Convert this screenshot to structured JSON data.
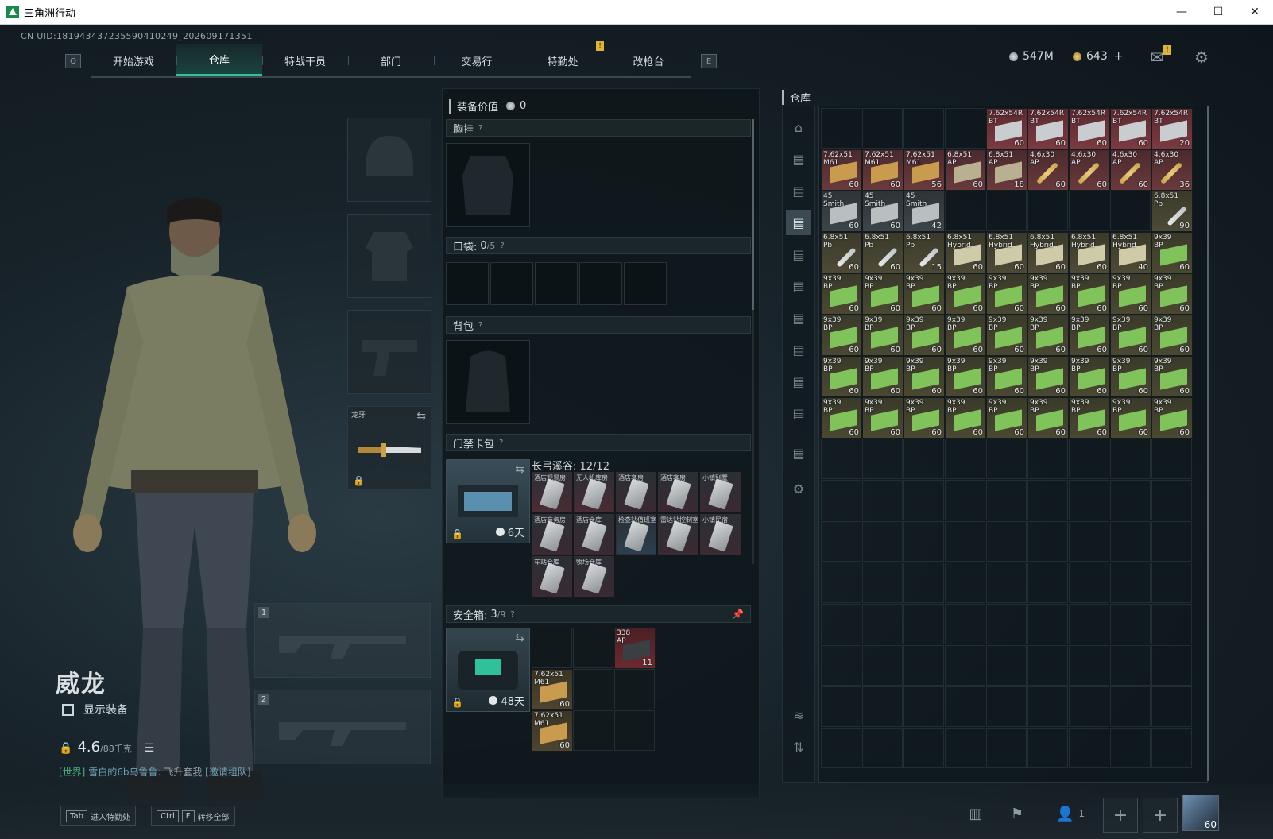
{
  "window": {
    "title": "三角洲行动"
  },
  "uid": "CN UID:18194343723559041024​9_202609171351",
  "nav": {
    "left_key": "Q",
    "right_key": "E",
    "tabs": [
      {
        "label": "开始游戏"
      },
      {
        "label": "仓库"
      },
      {
        "label": "特战干员"
      },
      {
        "label": "部门"
      },
      {
        "label": "交易行"
      },
      {
        "label": "特勤处",
        "badge": "!"
      },
      {
        "label": "改枪台"
      }
    ]
  },
  "currency": {
    "silver": "547M",
    "gold": "643",
    "gold_plus": "+",
    "mail_badge": "!"
  },
  "character": {
    "name": "威龙",
    "show_equipment": "显示装备",
    "weight_value": "4.6",
    "weight_max": "/88千克"
  },
  "chat": {
    "channel": "[世界]",
    "sender": "雪白的6b乌鲁鲁:",
    "message": "飞升套我",
    "link": "[邀请组队]"
  },
  "gear": {
    "knife_label": "龙牙",
    "weapon_slot_1": "1",
    "weapon_slot_2": "2"
  },
  "equip_panel": {
    "title": "装备价值",
    "value": "0",
    "chest_rig": "胸挂",
    "pocket": "口袋:",
    "pocket_count": "0",
    "pocket_max": "/5",
    "backpack": "背包",
    "keycard_bag": "门禁卡包",
    "keycard_title": "长弓溪谷: 12/12",
    "keycard_timer": "6天",
    "safe_box": "安全箱:",
    "safe_count": "3",
    "safe_max": "/9",
    "safe_timer": "48天",
    "question": "?"
  },
  "keycards": [
    {
      "name": "酒店观景房"
    },
    {
      "name": "无人机库房"
    },
    {
      "name": "酒店套房"
    },
    {
      "name": "酒店客房"
    },
    {
      "name": "小镇别墅"
    },
    {
      "name": "酒店商务房"
    },
    {
      "name": "酒店仓库"
    },
    {
      "name": "检查站值班室"
    },
    {
      "name": "雷达站控制室"
    },
    {
      "name": "小镇民宿"
    },
    {
      "name": "车站仓库"
    },
    {
      "name": "牧场仓库"
    }
  ],
  "safe_items": [
    {
      "name": "338\nAP",
      "count": "11"
    },
    {
      "name": "7.62x51\nM61",
      "count": "60"
    },
    {
      "name": "7.62x51\nM61",
      "count": "60"
    }
  ],
  "storage": {
    "title": "仓库",
    "items": [
      {
        "name": "7.62x54R\nBT",
        "count": "60"
      },
      {
        "name": "7.62x54R\nBT",
        "count": "60"
      },
      {
        "name": "7.62x54R\nBT",
        "count": "60"
      },
      {
        "name": "7.62x54R\nBT",
        "count": "60"
      },
      {
        "name": "7.62x54R\nBT",
        "count": "20"
      },
      {
        "name": "7.62x51\nM61",
        "count": "60"
      },
      {
        "name": "7.62x51\nM61",
        "count": "60"
      },
      {
        "name": "7.62x51\nM61",
        "count": "56"
      },
      {
        "name": "6.8x51\nAP",
        "count": "60"
      },
      {
        "name": "6.8x51\nAP",
        "count": "18"
      },
      {
        "name": "4.6x30\nAP",
        "count": "60"
      },
      {
        "name": "4.6x30\nAP",
        "count": "60"
      },
      {
        "name": "4.6x30\nAP",
        "count": "60"
      },
      {
        "name": "4.6x30\nAP",
        "count": "36"
      },
      {
        "name": "45\nSmith",
        "count": "60"
      },
      {
        "name": "45\nSmith",
        "count": "60"
      },
      {
        "name": "45\nSmith",
        "count": "42"
      },
      {
        "name": "6.8x51\nPb",
        "count": "90"
      },
      {
        "name": "6.8x51\nPb",
        "count": "60"
      },
      {
        "name": "6.8x51\nPb",
        "count": "60"
      },
      {
        "name": "6.8x51\nPb",
        "count": "15"
      },
      {
        "name": "6.8x51\nHybrid",
        "count": "60"
      },
      {
        "name": "6.8x51\nHybrid",
        "count": "60"
      },
      {
        "name": "6.8x51\nHybrid",
        "count": "60"
      },
      {
        "name": "6.8x51\nHybrid",
        "count": "60"
      },
      {
        "name": "6.8x51\nHybrid",
        "count": "40"
      },
      {
        "name": "9x39\nBP",
        "count": "60"
      },
      {
        "name": "9x39\nBP",
        "count": "60"
      },
      {
        "name": "9x39\nBP",
        "count": "60"
      },
      {
        "name": "9x39\nBP",
        "count": "60"
      },
      {
        "name": "9x39\nBP",
        "count": "60"
      },
      {
        "name": "9x39\nBP",
        "count": "60"
      },
      {
        "name": "9x39\nBP",
        "count": "60"
      },
      {
        "name": "9x39\nBP",
        "count": "60"
      },
      {
        "name": "9x39\nBP",
        "count": "60"
      },
      {
        "name": "9x39\nBP",
        "count": "60"
      },
      {
        "name": "9x39\nBP",
        "count": "60"
      },
      {
        "name": "9x39\nBP",
        "count": "60"
      },
      {
        "name": "9x39\nBP",
        "count": "60"
      },
      {
        "name": "9x39\nBP",
        "count": "60"
      },
      {
        "name": "9x39\nBP",
        "count": "60"
      },
      {
        "name": "9x39\nBP",
        "count": "60"
      },
      {
        "name": "9x39\nBP",
        "count": "60"
      },
      {
        "name": "9x39\nBP",
        "count": "60"
      },
      {
        "name": "9x39\nBP",
        "count": "60"
      },
      {
        "name": "9x39\nBP",
        "count": "60"
      },
      {
        "name": "9x39\nBP",
        "count": "60"
      },
      {
        "name": "9x39\nBP",
        "count": "60"
      },
      {
        "name": "9x39\nBP",
        "count": "60"
      },
      {
        "name": "9x39\nBP",
        "count": "60"
      },
      {
        "name": "9x39\nBP",
        "count": "60"
      },
      {
        "name": "9x39\nBP",
        "count": "60"
      },
      {
        "name": "9x39\nBP",
        "count": "60"
      },
      {
        "name": "9x39\nBP",
        "count": "60"
      },
      {
        "name": "9x39\nBP",
        "count": "60"
      },
      {
        "name": "9x39\nBP",
        "count": "60"
      },
      {
        "name": "9x39\nBP",
        "count": "60"
      },
      {
        "name": "9x39\nBP",
        "count": "60"
      },
      {
        "name": "9x39\nBP",
        "count": "60"
      },
      {
        "name": "9x39\nBP",
        "count": "60"
      },
      {
        "name": "9x39\nBP",
        "count": "60"
      },
      {
        "name": "9x39\nBP",
        "count": "60"
      },
      {
        "name": "9x39\nBP",
        "count": "60"
      },
      {
        "name": "9x39\nBP",
        "count": "60"
      },
      {
        "name": "9x39\nBP",
        "count": "60"
      },
      {
        "name": "9x39\nBP",
        "count": "60"
      }
    ]
  },
  "bottom": {
    "tab_key": "Tab",
    "tab_label": "进入特勤处",
    "ctrl_key": "Ctrl",
    "f_key": "F",
    "transfer_label": "转移全部",
    "squad_count": "1",
    "avatar_level": "60"
  },
  "colors": {
    "accent": "#2fc19a",
    "badge": "#e0b432"
  }
}
